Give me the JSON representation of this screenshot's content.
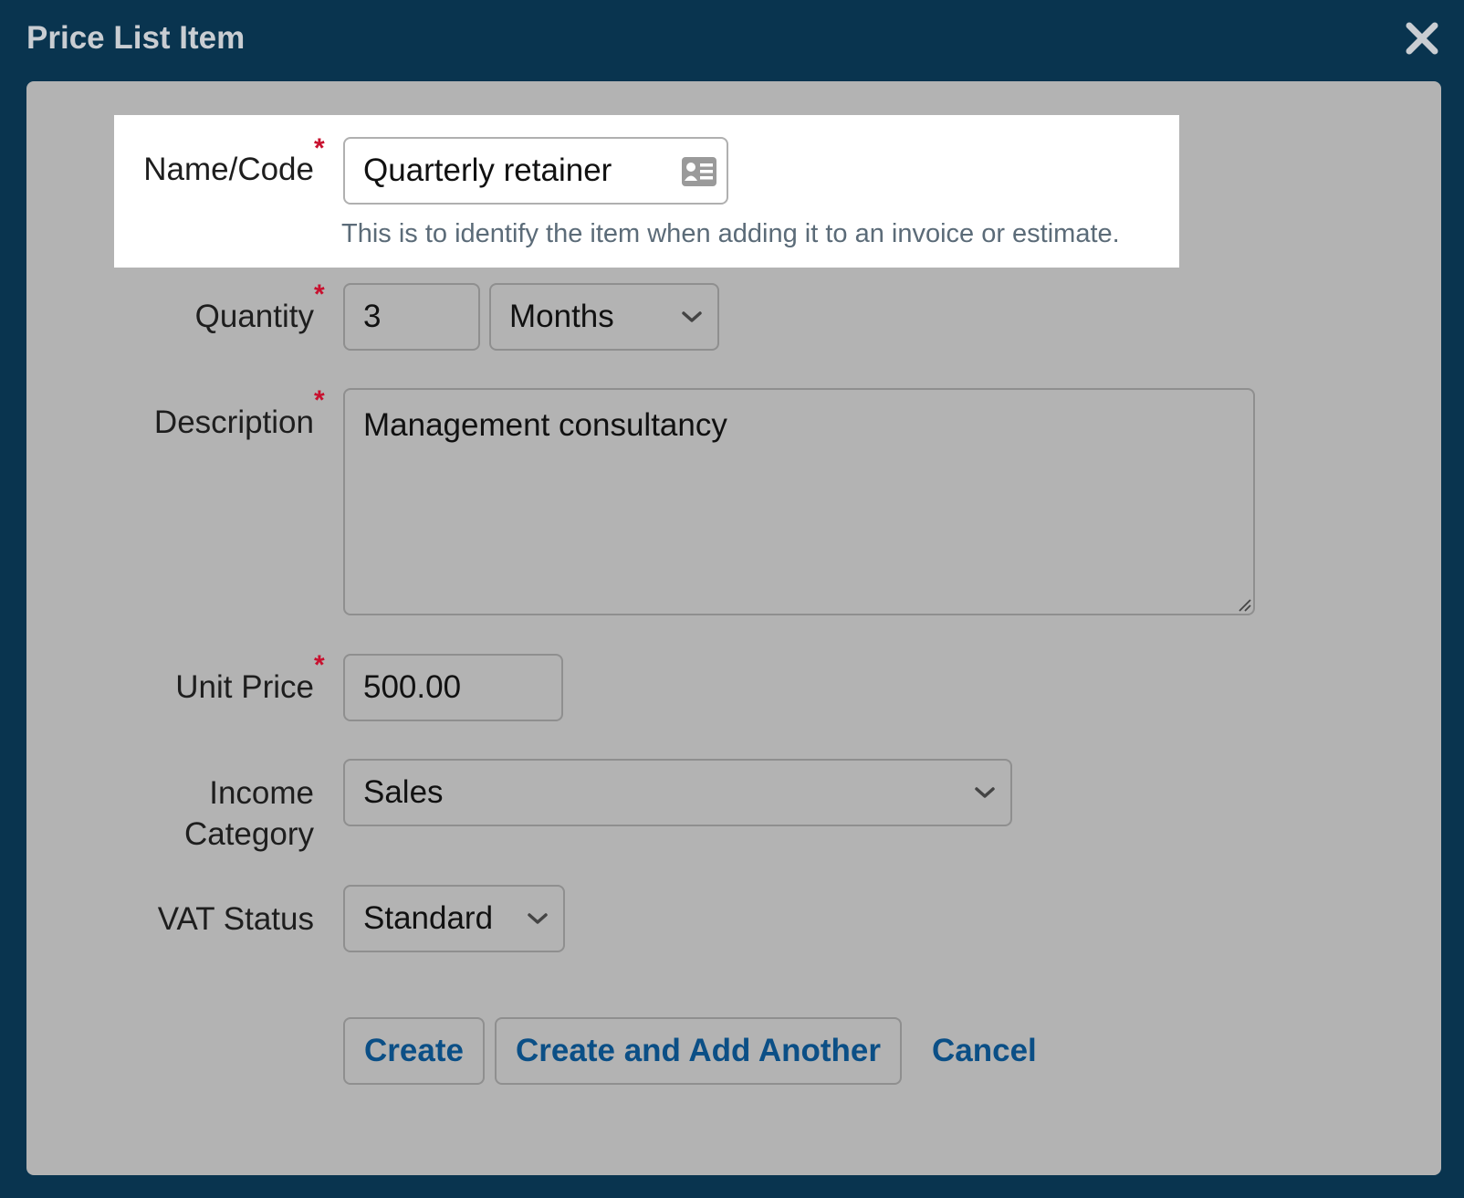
{
  "dialog": {
    "title": "Price List Item"
  },
  "form": {
    "name_code": {
      "label": "Name/Code",
      "value": "Quarterly retainer",
      "hint": "This is to identify the item when adding it to an invoice or estimate.",
      "required": true
    },
    "quantity": {
      "label": "Quantity",
      "value": "3",
      "unit": "Months",
      "required": true
    },
    "description": {
      "label": "Description",
      "value": "Management consultancy",
      "required": true
    },
    "unit_price": {
      "label": "Unit Price",
      "value": "500.00",
      "required": true
    },
    "income_category": {
      "label_line1": "Income",
      "label_line2": "Category",
      "value": "Sales"
    },
    "vat_status": {
      "label": "VAT Status",
      "value": "Standard"
    },
    "required_marker": "*"
  },
  "actions": {
    "create": "Create",
    "create_another": "Create and Add Another",
    "cancel": "Cancel"
  },
  "colors": {
    "header_bg": "#09344f",
    "panel_bg": "#b3b3b3",
    "link_blue": "#0b4f86",
    "required_red": "#c8102e"
  }
}
